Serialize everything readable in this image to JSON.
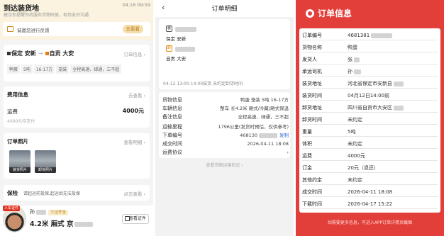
{
  "left": {
    "title": "到达装货地",
    "time": "04.16 09:59",
    "subtitle": "建议你提醒司机服务货物码放，现场友好沟通",
    "evaluate_prompt": "诚邀您进行反馈",
    "evaluate_btn": "去看看",
    "route": {
      "from": "保定 安新",
      "to": "自贡 大安",
      "link": "订单信息 ›",
      "tags": [
        "鸭蛋",
        "5吨",
        "16-17方",
        "笼装",
        "全程高速、绿通，三不超"
      ]
    },
    "fee": {
      "header": "费用信息",
      "link": "去查看 ›",
      "label": "运费",
      "value": "4000元",
      "sub": "4000元待支付"
    },
    "photos": {
      "header": "订单照片",
      "link": "查看明细 ›",
      "captions": [
        "装货照片",
        "卸货照片"
      ]
    },
    "insurance": {
      "header": "保险",
      "text": "请起运前投保,起运后无法投保",
      "link": "点击查看 ›"
    },
    "driver": {
      "badge": "人车证件",
      "name": "孙",
      "cert_chip": "三证齐全",
      "vehicle": "4.2米 厢式  京",
      "cert_btn": "查看证件"
    }
  },
  "middle": {
    "back": "‹",
    "title": "订单明细",
    "from_icon": "装",
    "to_icon": "卸",
    "from_place": "保定 安新",
    "to_place": "自贡 大安",
    "time_line": "04-12 13:00-14:00装货  未约定卸货时间",
    "rows": [
      {
        "k": "货物信息",
        "v": "鸭蛋 笼装 5吨 16-17方"
      },
      {
        "k": "车辆信息",
        "v": "整车 长4.2米 厢式/冷藏/厢式保温"
      },
      {
        "k": "备注信息",
        "v": "全程高速、绿通，三不超"
      },
      {
        "k": "运输里程",
        "v": "1796公里(发货时预估，仅供参考)"
      },
      {
        "k": "下单编号",
        "v": "468130",
        "copy": "复制"
      },
      {
        "k": "成交时间",
        "v": "2026-04-11 18:08"
      },
      {
        "k": "运费协议",
        "v": "›"
      }
    ],
    "footer": "查看货物运输协议 ›"
  },
  "right": {
    "title": "订单信息",
    "rows": [
      {
        "k": "订单编号",
        "v": "4681381"
      },
      {
        "k": "货物名称",
        "v": "鸭蛋"
      },
      {
        "k": "发货人",
        "v": "张"
      },
      {
        "k": "承运司机",
        "v": "孙"
      },
      {
        "k": "装货地址",
        "v": "河北省保定市安新县"
      },
      {
        "k": "装货时间",
        "v": "04月12日14:00前"
      },
      {
        "k": "卸货地址",
        "v": "四川省自贡市大安区"
      },
      {
        "k": "卸货时间",
        "v": "未约定"
      },
      {
        "k": "重量",
        "v": "5吨"
      },
      {
        "k": "体积",
        "v": "未约定"
      },
      {
        "k": "运费",
        "v": "4000元"
      },
      {
        "k": "订金",
        "v": "20元（退还）"
      },
      {
        "k": "其他约定",
        "v": "未约定"
      },
      {
        "k": "成交时间",
        "v": "2026-04-11 18:08"
      },
      {
        "k": "下载时间",
        "v": "2026-04-17 15:22"
      }
    ],
    "footer": "如需要更多信息，可进入APP订单详情页截图"
  },
  "colors": {
    "accent_red": "#e33f3a",
    "accent_orange": "#e07a14",
    "link_blue": "#3a73d6",
    "banner_bg": "#fbf3df"
  }
}
